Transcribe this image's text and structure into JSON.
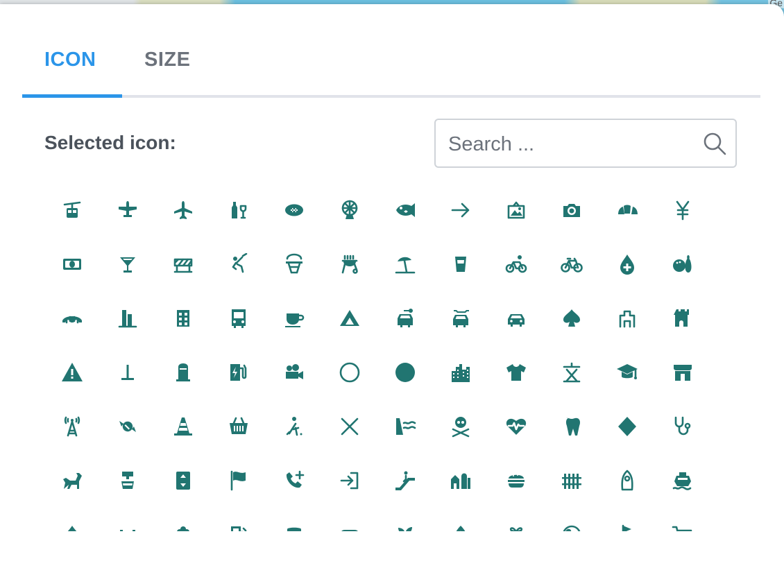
{
  "map": {
    "corner_label": "Ge"
  },
  "tabs": [
    {
      "label": "ICON",
      "active": true
    },
    {
      "label": "SIZE",
      "active": false
    }
  ],
  "selected_label": "Selected icon:",
  "search": {
    "placeholder": "Search ...",
    "value": ""
  },
  "colors": {
    "accent": "#2b95e9",
    "icon": "#217571",
    "muted": "#6c727b"
  },
  "icons": [
    "aerialway",
    "airfield",
    "airport",
    "alcohol-shop",
    "american-football",
    "amusement-park",
    "aquarium",
    "arrow",
    "art-gallery",
    "attraction",
    "bakery",
    "bank-jp",
    "bank",
    "bar",
    "barrier",
    "baseball",
    "basketball",
    "bbq",
    "beach",
    "beer",
    "bicycle-share",
    "bicycle",
    "blood-bank",
    "bowling-alley",
    "bridge",
    "building-alt1",
    "building",
    "bus",
    "cafe",
    "campsite",
    "car-rental",
    "car-repair",
    "car",
    "card",
    "castle-jp",
    "castle",
    "caution",
    "cemetery-jp",
    "cemetery",
    "charging-station",
    "cinema",
    "circle-stroked",
    "circle",
    "city",
    "clothing-store",
    "college-jp",
    "college",
    "commercial",
    "communications-tower",
    "confectionery",
    "construction",
    "convenience",
    "cricket",
    "cross",
    "dam",
    "danger",
    "defibrillator",
    "dentist",
    "diamond",
    "doctor",
    "dog-park",
    "drinking-water",
    "elevator",
    "embassy",
    "emergency-phone",
    "entrance",
    "escalator",
    "farm",
    "fast-food",
    "fence",
    "ferry-jp",
    "ferry",
    "fire-station",
    "fitness-centre",
    "florist",
    "fuel",
    "furniture",
    "gaming",
    "garden-centre",
    "garden",
    "gift",
    "globe",
    "golf",
    "grocery"
  ]
}
